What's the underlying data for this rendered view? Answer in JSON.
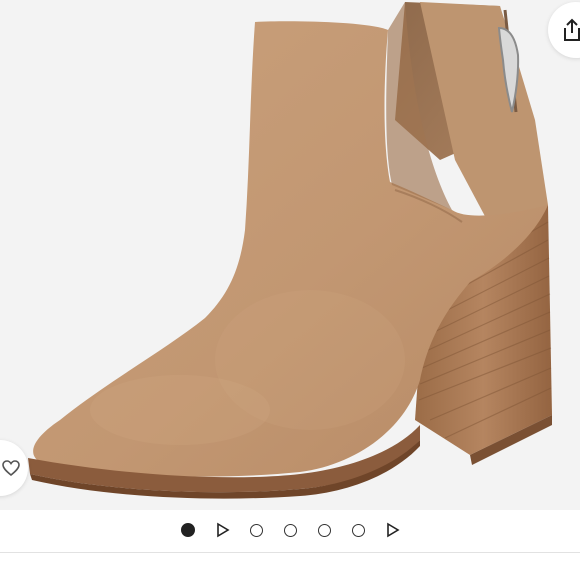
{
  "viewer": {
    "image_icon": "ankle-bootie-product-image",
    "background_color": "#f3f3f3",
    "suede_color": "#c69c76",
    "heel_color": "#a97952"
  },
  "actions": {
    "share_icon": "share-icon",
    "wishlist_icon": "heart-icon"
  },
  "pager": {
    "items": [
      {
        "type": "dot",
        "active": true
      },
      {
        "type": "video-play",
        "active": false
      },
      {
        "type": "dot",
        "active": false
      },
      {
        "type": "dot",
        "active": false
      },
      {
        "type": "dot",
        "active": false
      },
      {
        "type": "dot",
        "active": false
      },
      {
        "type": "video-play",
        "active": false
      }
    ]
  }
}
